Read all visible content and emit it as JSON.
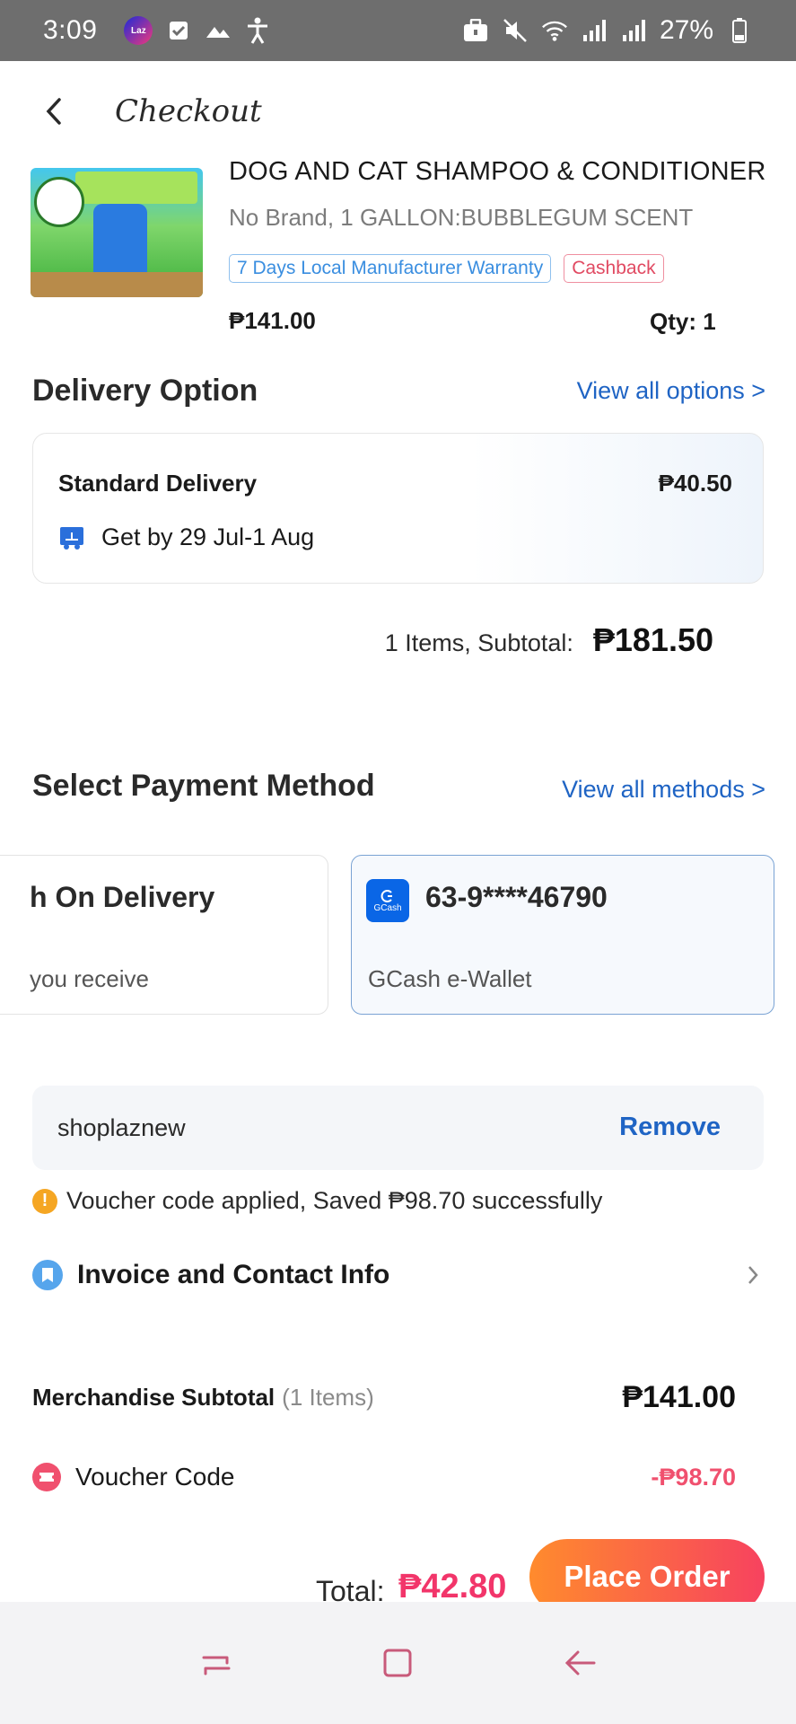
{
  "status_bar": {
    "time": "3:09",
    "battery": "27%",
    "icons": [
      "lazada-app-icon",
      "checkbox-icon",
      "mountain-icon",
      "accessibility-icon",
      "briefcase-icon",
      "mute-icon",
      "wifi-icon",
      "signal-icon",
      "signal-icon",
      "battery-icon"
    ]
  },
  "header": {
    "title": "Checkout"
  },
  "product": {
    "name": "DOG AND CAT SHAMPOO & CONDITIONER",
    "variant": "No Brand, 1 GALLON:BUBBLEGUM SCENT",
    "tags": [
      "7 Days Local Manufacturer Warranty",
      "Cashback"
    ],
    "price": "₱141.00",
    "qty": "Qty: 1"
  },
  "delivery": {
    "section_title": "Delivery Option",
    "view_all": "View all options >",
    "option_name": "Standard Delivery",
    "option_price": "₱40.50",
    "eta": "Get by 29 Jul-1 Aug",
    "subtotal_label": "1 Items, Subtotal:",
    "subtotal_value": "₱181.50"
  },
  "payment": {
    "section_title": "Select Payment Method",
    "view_all": "View all methods >",
    "methods": [
      {
        "title": "h On Delivery",
        "subtitle": "you receive"
      },
      {
        "title": "63-9****46790",
        "subtitle": "GCash e-Wallet",
        "logo_text": "GCash"
      }
    ]
  },
  "voucher": {
    "code": "shoplaznew",
    "remove": "Remove",
    "message": "Voucher code applied, Saved ₱98.70 successfully"
  },
  "invoice": {
    "label": "Invoice and Contact Info"
  },
  "summary": {
    "merch_label": "Merchandise Subtotal",
    "merch_count": "(1 Items)",
    "merch_value": "₱141.00",
    "voucher_label": "Voucher Code",
    "voucher_value": "-₱98.70"
  },
  "footer": {
    "total_label": "Total:",
    "total_value": "₱42.80",
    "place_order": "Place Order"
  },
  "colors": {
    "link_blue": "#1f64c4",
    "accent_pink": "#f2356a",
    "button_gradient_start": "#ff8b2d",
    "button_gradient_end": "#f7425f"
  }
}
